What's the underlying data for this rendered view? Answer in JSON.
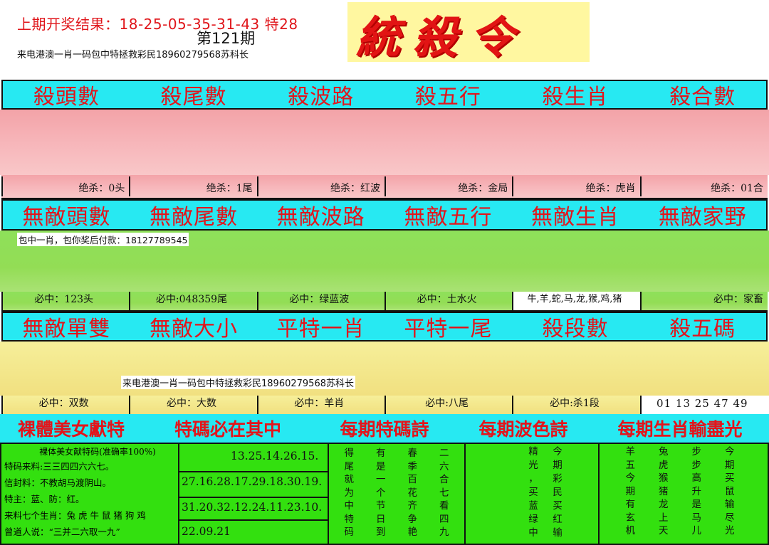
{
  "header": {
    "result_text": "上期开奖结果：18-25-05-35-31-43 特28",
    "issue": "第121期",
    "logo": "統殺令",
    "ad": "来电港澳一肖一码包中特拯救彩民18960279568苏科长"
  },
  "row1": {
    "titles": [
      "殺頭數",
      "殺尾數",
      "殺波路",
      "殺五行",
      "殺生肖",
      "殺合數"
    ],
    "cells": [
      "绝杀：0头",
      "绝杀：1尾",
      "绝杀：红波",
      "绝杀：金局",
      "绝杀：虎肖",
      "绝杀：01合"
    ]
  },
  "row2": {
    "titles": [
      "無敵頭數",
      "無敵尾數",
      "無敵波路",
      "無敵五行",
      "無敵生肖",
      "無敵家野"
    ],
    "note": "包中一肖，包你奖后付款：18127789545",
    "cells": [
      "必中：123头",
      "必中:048359尾",
      "必中：绿蓝波",
      "必中：土水火",
      "牛,羊,蛇,马,龙,猴,鸡,猪",
      "必中：家畜"
    ]
  },
  "row3": {
    "titles": [
      "無敵單雙",
      "無敵大小",
      "平特一肖",
      "平特一尾",
      "殺段數",
      "殺五碼"
    ],
    "note": "来电港澳一肖一码包中特拯救彩民18960279568苏科长",
    "cells": [
      "必中：双数",
      "必中：大数",
      "必中：羊肖",
      "必中:八尾",
      "必中:杀1段",
      "01  13  25  47  49"
    ]
  },
  "bottom_head": [
    "裸體美女獻特",
    "特碼必在其中",
    "每期特碼詩",
    "每期波色詩",
    "每期生肖輸盡光"
  ],
  "col1": {
    "title": "裸体美女献特码(准确率100%)",
    "lines": [
      "特码来料:三三四四六六七。",
      "信封料：不教胡马渡阴山。",
      "特主：蓝、防：红。",
      "来料七个生肖：兔 虎 牛 鼠 猪 狗 鸡",
      "曾道人说：“三并二六取一九”"
    ]
  },
  "col2": {
    "lines": [
      "13.25.14.26.15.",
      "27.16.28.17.29.18.30.19.",
      "31.20.32.12.24.11.23.10.",
      "22.09.21"
    ]
  },
  "poem1": [
    "得",
    "有",
    "春",
    "二",
    "尾",
    "是",
    "季",
    "六",
    "就",
    "一",
    "百",
    "合",
    "为",
    "个",
    "花",
    "七",
    "中",
    "节",
    "齐",
    "看",
    "特",
    "日",
    "争",
    "四",
    "码",
    "到",
    "艳",
    "九"
  ],
  "poem2": [
    "精",
    "今",
    "光",
    "期",
    "，",
    "彩",
    "买",
    "民",
    "蓝",
    "买",
    "绿",
    "红",
    "中",
    "输"
  ],
  "poem3": [
    "羊",
    "兔",
    "步",
    "今",
    "五",
    "虎",
    "步",
    "期",
    "今",
    "猴",
    "高",
    "买",
    "期",
    "猪",
    "升",
    "鼠",
    "有",
    "龙",
    "是",
    "输",
    "玄",
    "上",
    "马",
    "尽",
    "机",
    "天",
    "儿",
    "光"
  ]
}
